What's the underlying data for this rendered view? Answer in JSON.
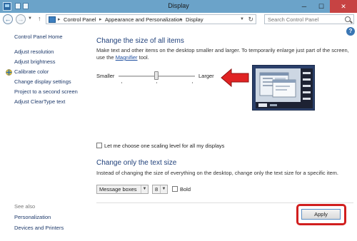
{
  "window": {
    "title": "Display",
    "controls": {
      "minimize": "─",
      "maximize": "☐",
      "close": "✕"
    }
  },
  "address_bar": {
    "breadcrumbs": [
      "Control Panel",
      "Appearance and Personalization",
      "Display"
    ],
    "separator": "▸",
    "search_placeholder": "Search Control Panel"
  },
  "sidebar": {
    "home_label": "Control Panel Home",
    "items": [
      {
        "label": "Adjust resolution"
      },
      {
        "label": "Adjust brightness"
      },
      {
        "label": "Calibrate color"
      },
      {
        "label": "Change display settings"
      },
      {
        "label": "Project to a second screen"
      },
      {
        "label": "Adjust ClearType text"
      }
    ],
    "see_also_label": "See also",
    "see_also_items": [
      {
        "label": "Personalization"
      },
      {
        "label": "Devices and Printers"
      }
    ]
  },
  "main": {
    "size_heading": "Change the size of all items",
    "size_description_before": "Make text and other items on the desktop smaller and larger. To temporarily enlarge just part of the screen, use the ",
    "size_description_link": "Magnifier",
    "size_description_after": " tool.",
    "slider": {
      "min_label": "Smaller",
      "max_label": "Larger",
      "level": 0.5
    },
    "custom_scaling_label": "Let me choose one scaling level for all my displays",
    "text_heading": "Change only the text size",
    "text_description": "Instead of changing the size of everything on the desktop, change only the text size for a specific item.",
    "item_select_value": "Message boxes",
    "font_size_value": "8",
    "bold_label": "Bold",
    "apply_label": "Apply"
  },
  "colors": {
    "title_bar": "#6ba3c9",
    "heading": "#1e3f7a",
    "link": "#1e3a6b",
    "annotation_red": "#d11f1f"
  }
}
